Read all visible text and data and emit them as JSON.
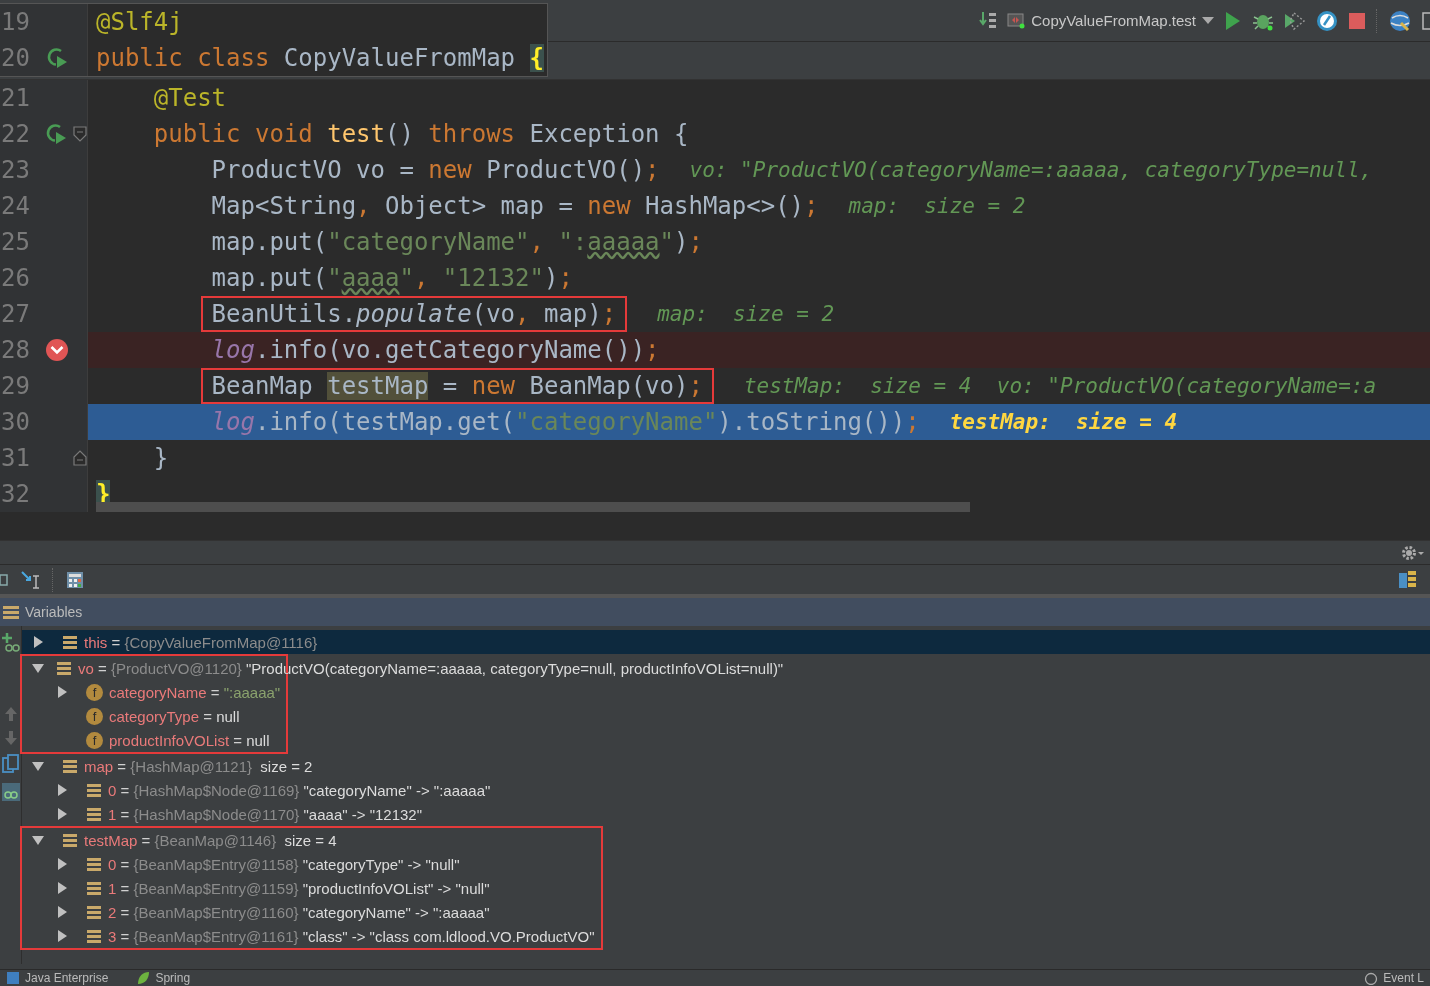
{
  "toolbar": {
    "run_config": "CopyValueFromMap.test"
  },
  "code": [
    {
      "number": "19",
      "fold_marker": false,
      "runnable": false,
      "breakpoint": false,
      "current": false,
      "boxed": false,
      "tokens": [
        {
          "text": "@Slf4j",
          "kind": "annotation"
        }
      ]
    },
    {
      "number": "20",
      "fold_marker": false,
      "runnable": true,
      "breakpoint": false,
      "current": false,
      "boxed": false,
      "tokens": [
        {
          "text": "public",
          "kind": "keyword"
        },
        {
          "text": " class",
          "kind": "keyword"
        },
        {
          "text": " CopyValueFromMap ",
          "kind": "plain"
        },
        {
          "text": "{",
          "kind": "brace"
        }
      ],
      "children": [
        {
          "number": "21",
          "fold_marker": false,
          "runnable": false,
          "breakpoint": false,
          "current": false,
          "boxed": false,
          "tokens": [
            {
              "text": "@Test",
              "kind": "annotation"
            }
          ]
        },
        {
          "number": "22",
          "fold_marker": true,
          "runnable": true,
          "breakpoint": false,
          "current": false,
          "boxed": false,
          "tokens": [
            {
              "text": "public",
              "kind": "keyword"
            },
            {
              "text": " void",
              "kind": "keyword"
            },
            {
              "text": " test",
              "kind": "method"
            },
            {
              "text": "() ",
              "kind": "plain"
            },
            {
              "text": "throws",
              "kind": "keyword"
            },
            {
              "text": " Exception {",
              "kind": "plain"
            }
          ],
          "children": [
            {
              "number": "23",
              "fold_marker": false,
              "runnable": false,
              "breakpoint": false,
              "current": false,
              "boxed": false,
              "tokens": [
                {
                  "text": "ProductVO vo = ",
                  "kind": "plain"
                },
                {
                  "text": "new",
                  "kind": "keyword"
                },
                {
                  "text": " ProductVO()",
                  "kind": "plain"
                },
                {
                  "text": ";",
                  "kind": "punct"
                }
              ],
              "hint": "vo: \"ProductVO(categoryName=:aaaaa, categoryType=null,"
            },
            {
              "number": "24",
              "fold_marker": false,
              "runnable": false,
              "breakpoint": false,
              "current": false,
              "boxed": false,
              "tokens": [
                {
                  "text": "Map<String",
                  "kind": "plain"
                },
                {
                  "text": ",",
                  "kind": "punct"
                },
                {
                  "text": " Object> map = ",
                  "kind": "plain"
                },
                {
                  "text": "new",
                  "kind": "keyword"
                },
                {
                  "text": " HashMap<>()",
                  "kind": "plain"
                },
                {
                  "text": ";",
                  "kind": "punct"
                }
              ],
              "hint": "map:  size = 2"
            },
            {
              "number": "25",
              "fold_marker": false,
              "runnable": false,
              "breakpoint": false,
              "current": false,
              "boxed": false,
              "tokens": [
                {
                  "text": "map.put(",
                  "kind": "plain"
                },
                {
                  "text": "\"categoryName\"",
                  "kind": "string"
                },
                {
                  "text": ",",
                  "kind": "punct"
                },
                {
                  "text": " \":",
                  "kind": "string"
                },
                {
                  "text": "aaaaa",
                  "kind": "typo"
                },
                {
                  "text": "\"",
                  "kind": "string"
                },
                {
                  "text": ")",
                  "kind": "plain"
                },
                {
                  "text": ";",
                  "kind": "punct"
                }
              ]
            },
            {
              "number": "26",
              "fold_marker": false,
              "runnable": false,
              "breakpoint": false,
              "current": false,
              "boxed": false,
              "tokens": [
                {
                  "text": "map.put(",
                  "kind": "plain"
                },
                {
                  "text": "\"",
                  "kind": "string"
                },
                {
                  "text": "aaaa",
                  "kind": "typo"
                },
                {
                  "text": "\"",
                  "kind": "string"
                },
                {
                  "text": ",",
                  "kind": "punct"
                },
                {
                  "text": " \"12132\"",
                  "kind": "string"
                },
                {
                  "text": ")",
                  "kind": "plain"
                },
                {
                  "text": ";",
                  "kind": "punct"
                }
              ]
            },
            {
              "number": "27",
              "fold_marker": false,
              "runnable": false,
              "breakpoint": false,
              "current": false,
              "boxed": true,
              "tokens": [
                {
                  "text": "BeanUtils.",
                  "kind": "plain"
                },
                {
                  "text": "populate",
                  "kind": "italic"
                },
                {
                  "text": "(vo",
                  "kind": "plain"
                },
                {
                  "text": ",",
                  "kind": "punct"
                },
                {
                  "text": " map)",
                  "kind": "plain"
                },
                {
                  "text": ";",
                  "kind": "punct"
                }
              ],
              "hint": "map:  size = 2"
            },
            {
              "number": "28",
              "fold_marker": false,
              "runnable": false,
              "breakpoint": true,
              "current": false,
              "boxed": false,
              "tokens": [
                {
                  "text": "log",
                  "kind": "static"
                },
                {
                  "text": ".info(vo.getCategoryName())",
                  "kind": "plain"
                },
                {
                  "text": ";",
                  "kind": "punct"
                }
              ]
            },
            {
              "number": "29",
              "fold_marker": false,
              "runnable": false,
              "breakpoint": false,
              "current": false,
              "boxed": true,
              "tokens": [
                {
                  "text": "BeanMap ",
                  "kind": "plain"
                },
                {
                  "text": "testMap",
                  "kind": "usage"
                },
                {
                  "text": " = ",
                  "kind": "plain"
                },
                {
                  "text": "new",
                  "kind": "keyword"
                },
                {
                  "text": " BeanMap(vo)",
                  "kind": "plain"
                },
                {
                  "text": ";",
                  "kind": "punct"
                }
              ],
              "hint": "testMap:  size = 4  vo: \"ProductVO(categoryName=:a"
            },
            {
              "number": "30",
              "fold_marker": false,
              "runnable": false,
              "breakpoint": false,
              "current": true,
              "boxed": false,
              "tokens": [
                {
                  "text": "log",
                  "kind": "static"
                },
                {
                  "text": ".info(testMap.get(",
                  "kind": "plain"
                },
                {
                  "text": "\"categoryName\"",
                  "kind": "string"
                },
                {
                  "text": ").toString())",
                  "kind": "plain"
                },
                {
                  "text": ";",
                  "kind": "punct"
                }
              ],
              "hint": "testMap:  size = 4"
            }
          ]
        },
        {
          "number": "31",
          "fold_marker": true,
          "runnable": false,
          "breakpoint": false,
          "current": false,
          "boxed": false,
          "tokens": [
            {
              "text": "}",
              "kind": "plain"
            }
          ]
        }
      ]
    },
    {
      "number": "32",
      "fold_marker": false,
      "runnable": false,
      "breakpoint": false,
      "current": false,
      "boxed": false,
      "tokens": [
        {
          "text": "}",
          "kind": "brace"
        }
      ]
    }
  ],
  "debugger": {
    "panel_title": "Variables",
    "variables": [
      {
        "name": "this",
        "sep": "=",
        "ref": "{CopyValueFromMap@1116}",
        "kind": "object",
        "selected": true,
        "expandable": true,
        "expanded": false,
        "boxed": false
      },
      {
        "name": "vo",
        "sep": "=",
        "ref": "{ProductVO@1120}",
        "value": "\"ProductVO(categoryName=:aaaaa, categoryType=null, productInfoVOList=null)\"",
        "kind": "object",
        "selected": false,
        "expandable": true,
        "expanded": true,
        "boxed": true,
        "children": [
          {
            "name": "categoryName",
            "sep": "=",
            "string_value": "\":aaaaa\"",
            "kind": "field",
            "glyph": "f",
            "selected": false,
            "expandable": true,
            "expanded": false
          },
          {
            "name": "categoryType",
            "sep": "=",
            "value": "null",
            "kind": "field",
            "glyph": "f",
            "selected": false,
            "expandable": false
          },
          {
            "name": "productInfoVOList",
            "sep": "=",
            "value": "null",
            "kind": "field",
            "glyph": "f",
            "selected": false,
            "expandable": false
          }
        ]
      },
      {
        "name": "map",
        "sep": "=",
        "ref": "{HashMap@1121}",
        "value": " size = 2",
        "kind": "object",
        "selected": false,
        "expandable": true,
        "expanded": true,
        "boxed": false,
        "children": [
          {
            "name": "0",
            "sep": "=",
            "ref": "{HashMap$Node@1169}",
            "value": "\"categoryName\" -> \":aaaaa\"",
            "kind": "object",
            "selected": false,
            "expandable": true,
            "expanded": false
          },
          {
            "name": "1",
            "sep": "=",
            "ref": "{HashMap$Node@1170}",
            "value": "\"aaaa\" -> \"12132\"",
            "kind": "object",
            "selected": false,
            "expandable": true,
            "expanded": false
          }
        ]
      },
      {
        "name": "testMap",
        "sep": "=",
        "ref": "{BeanMap@1146}",
        "value": " size = 4",
        "kind": "object",
        "selected": false,
        "expandable": true,
        "expanded": true,
        "boxed": true,
        "children": [
          {
            "name": "0",
            "sep": "=",
            "ref": "{BeanMap$Entry@1158}",
            "value": "\"categoryType\" -> \"null\"",
            "kind": "object",
            "selected": false,
            "expandable": true,
            "expanded": false
          },
          {
            "name": "1",
            "sep": "=",
            "ref": "{BeanMap$Entry@1159}",
            "value": "\"productInfoVOList\" -> \"null\"",
            "kind": "object",
            "selected": false,
            "expandable": true,
            "expanded": false
          },
          {
            "name": "2",
            "sep": "=",
            "ref": "{BeanMap$Entry@1160}",
            "value": "\"categoryName\" -> \":aaaaa\"",
            "kind": "object",
            "selected": false,
            "expandable": true,
            "expanded": false
          },
          {
            "name": "3",
            "sep": "=",
            "ref": "{BeanMap$Entry@1161}",
            "value": "\"class\" -> \"class com.ldlood.VO.ProductVO\"",
            "kind": "object",
            "selected": false,
            "expandable": true,
            "expanded": false
          }
        ]
      }
    ]
  },
  "status_bar": [
    {
      "label": "Java Enterprise",
      "kind": "javaee"
    },
    {
      "label": "Spring",
      "kind": "spring"
    },
    {
      "label": "Event L",
      "kind": "event"
    }
  ]
}
